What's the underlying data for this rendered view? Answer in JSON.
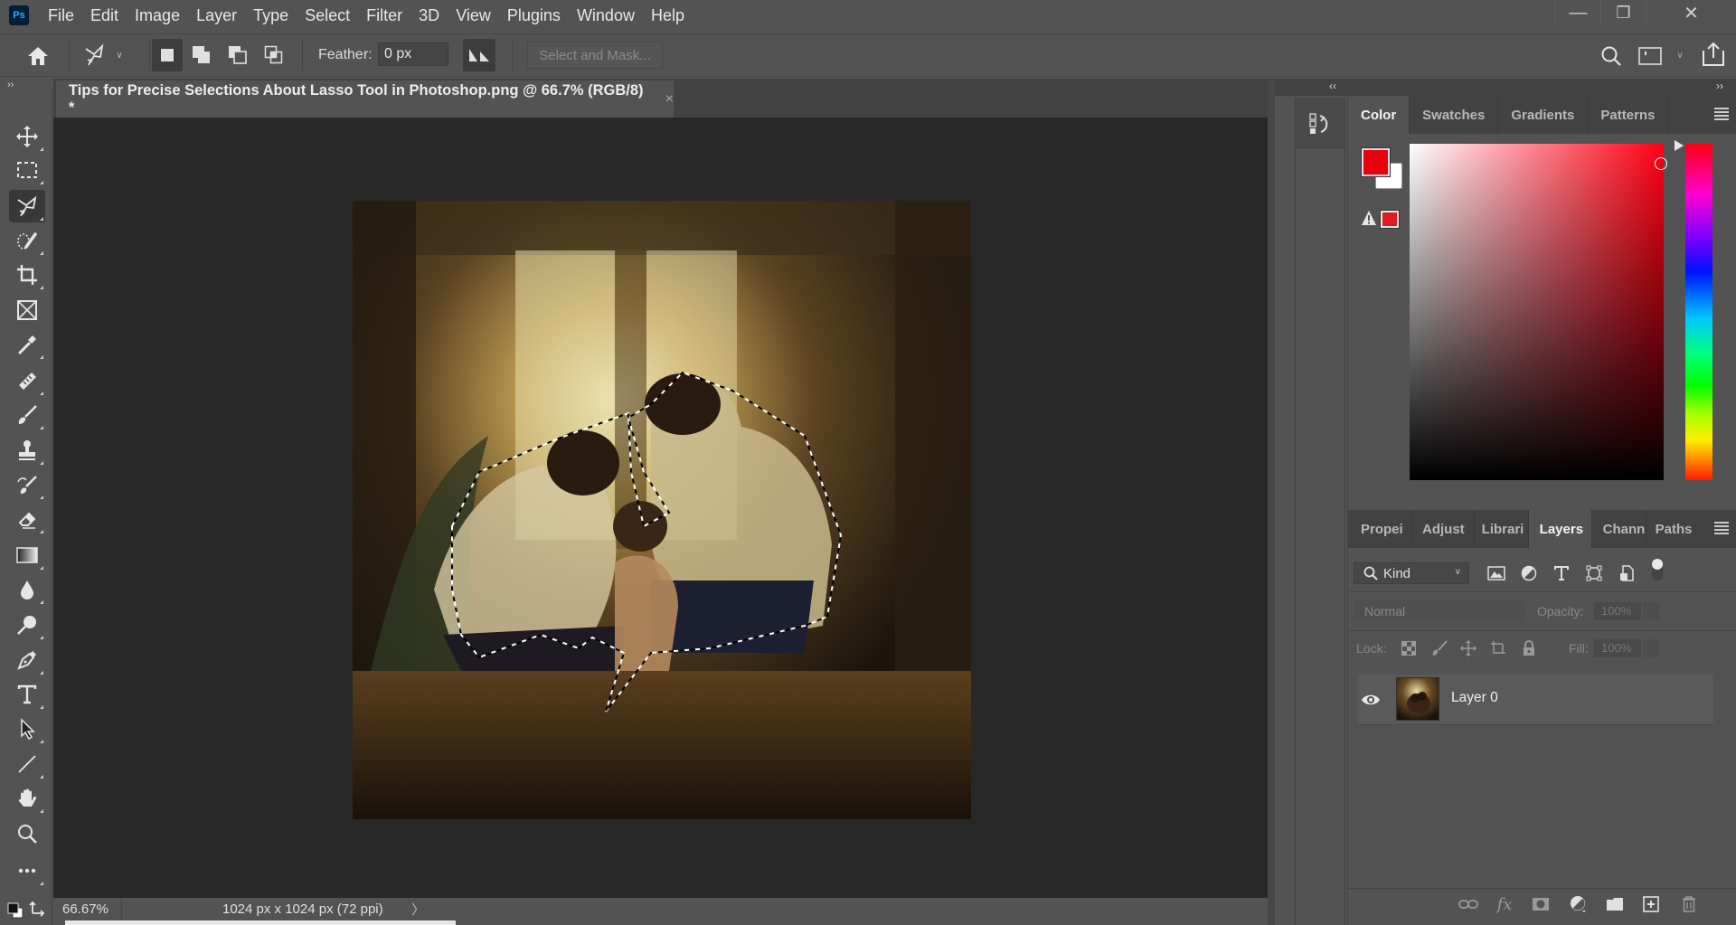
{
  "app": {
    "logo_text": "Ps"
  },
  "menu": [
    "File",
    "Edit",
    "Image",
    "Layer",
    "Type",
    "Select",
    "Filter",
    "3D",
    "View",
    "Plugins",
    "Window",
    "Help"
  ],
  "window_controls": {
    "minimize": "—",
    "restore": "❐",
    "close": "✕"
  },
  "options_bar": {
    "home_icon": "home-icon",
    "tool_preset": "polygonal-lasso-icon",
    "selection_modes": [
      "new-selection",
      "add-to-selection",
      "subtract-from-selection",
      "intersect-with-selection"
    ],
    "active_mode": "new-selection",
    "feather_label": "Feather:",
    "feather_value": "0 px",
    "antialias": "anti-alias",
    "select_and_mask_label": "Select and Mask..."
  },
  "document": {
    "tab_title": "Tips for Precise Selections About Lasso Tool in Photoshop.png @ 66.7% (RGB/8) *",
    "close_glyph": "×"
  },
  "toolbar": {
    "active_tool": "polygonal-lasso",
    "tools": [
      "move",
      "rectangular-marquee",
      "polygonal-lasso",
      "quick-selection",
      "crop",
      "frame",
      "eyedropper",
      "healing-brush",
      "brush",
      "clone-stamp",
      "history-brush",
      "eraser",
      "gradient",
      "blur",
      "dodge",
      "pen",
      "type",
      "path-selection",
      "line",
      "hand",
      "zoom",
      "more"
    ]
  },
  "status_bar": {
    "zoom": "66.67%",
    "dimensions": "1024 px x 1024 px (72 ppi)",
    "more_glyph": "〉"
  },
  "dock": {
    "collapse_left": "‹‹",
    "collapse_right": "››"
  },
  "color_panel": {
    "tabs": [
      "Color",
      "Swatches",
      "Gradients",
      "Patterns"
    ],
    "active_tab": "Color",
    "foreground_color": "#e8000e",
    "background_color": "#ffffff",
    "gamut_warning_color": "#e21a22",
    "hue_color": "#ff0014"
  },
  "layers_panel": {
    "tabs": [
      "Propei",
      "Adjust",
      "Librari",
      "Layers",
      "Chann",
      "Paths"
    ],
    "active_tab": "Layers",
    "filter_kind": "Kind",
    "blend_mode": "Normal",
    "opacity_label": "Opacity:",
    "opacity_value": "100%",
    "lock_label": "Lock:",
    "fill_label": "Fill:",
    "fill_value": "100%",
    "layers": [
      {
        "name": "Layer 0",
        "visible": true
      }
    ]
  }
}
